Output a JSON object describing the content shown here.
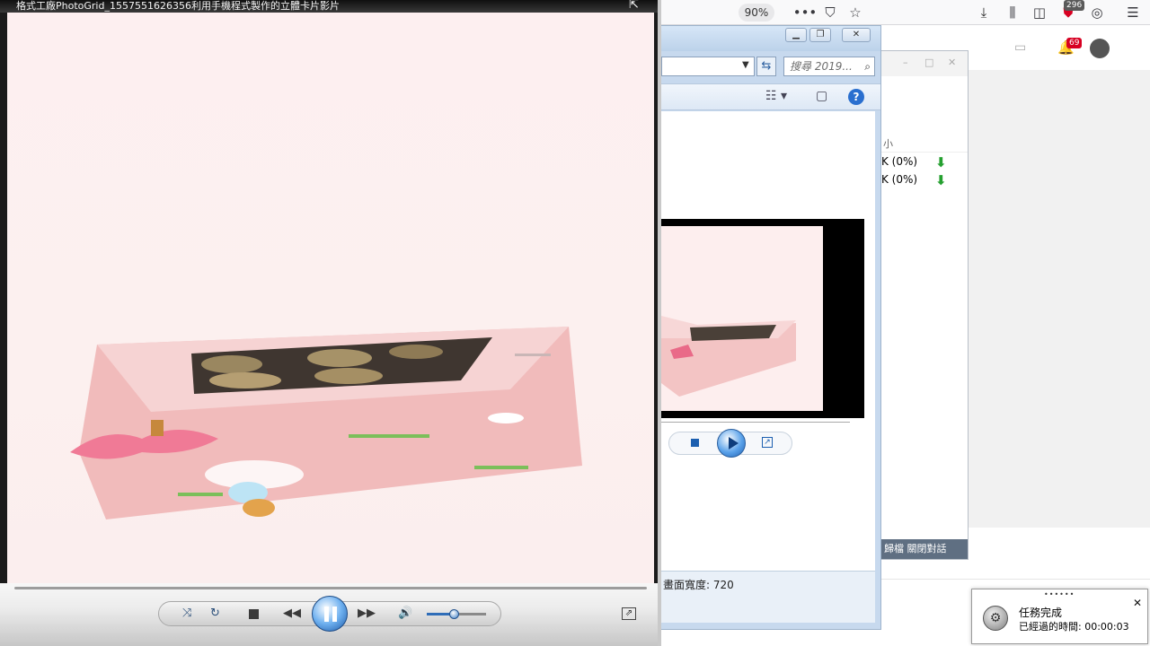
{
  "player": {
    "title": "格式工廠PhotoGrid_1557551626356利用手機程式製作的立體卡片影片",
    "state": "playing",
    "volume_level": 0.45
  },
  "browser": {
    "zoom": "90%",
    "notification_count": "296",
    "bell_count": "69"
  },
  "explorer": {
    "search_placeholder": "搜尋 2019...",
    "detail_text": "畫面寬度: 720"
  },
  "download_manager": {
    "column_header": "小",
    "rows": [
      {
        "progress_text": "K (0%)"
      },
      {
        "progress_text": "K (0%)"
      }
    ],
    "status_text": "歸檔  關閉對話"
  },
  "toast": {
    "title": "任務完成",
    "body": "已經過的時間: 00:00:03"
  },
  "colors": {
    "accent_blue": "#1f5fb1",
    "download_green": "#25a030",
    "badge_red": "#d70022",
    "video_bg": "#fdeff0",
    "card_pink": "#eeb1b1"
  }
}
